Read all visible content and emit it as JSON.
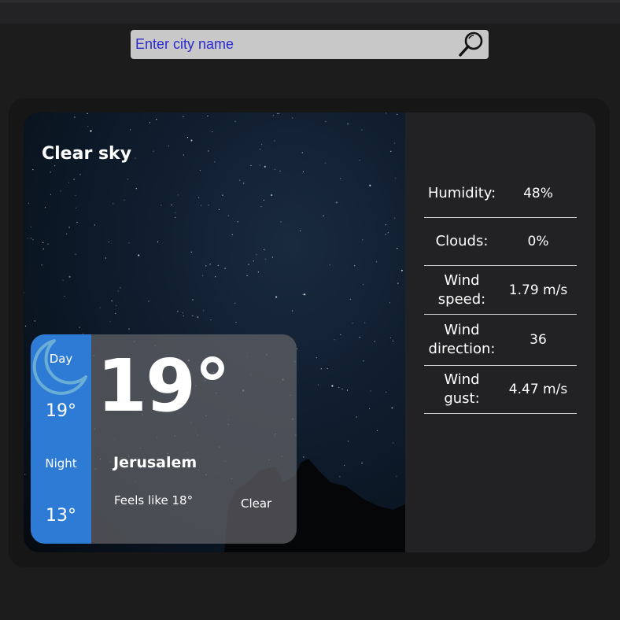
{
  "search": {
    "placeholder": "Enter city name"
  },
  "weather": {
    "description": "Clear sky",
    "day_label": "Day",
    "day_temp": "19°",
    "night_label": "Night",
    "night_temp": "13°",
    "temperature": "19°",
    "city": "Jerusalem",
    "feels_like": "Feels like 18°",
    "condition": "Clear",
    "icon": "crescent-moon-icon"
  },
  "details": [
    {
      "label": "Humidity:",
      "value": "48%"
    },
    {
      "label": "Clouds:",
      "value": "0%"
    },
    {
      "label": "Wind speed:",
      "value": "1.79 m/s"
    },
    {
      "label": "Wind direction:",
      "value": "36"
    },
    {
      "label": "Wind gust:",
      "value": "4.47 m/s"
    }
  ],
  "colors": {
    "accent_blue": "#2e7bd6",
    "moon_stroke": "#6aaed6",
    "search_text": "#2a2ad0"
  }
}
